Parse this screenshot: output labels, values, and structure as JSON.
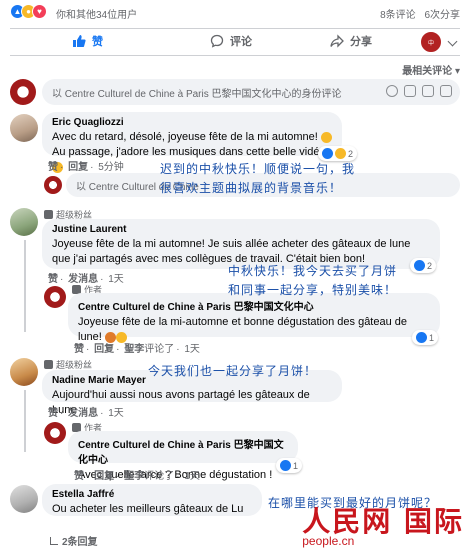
{
  "reactions_bar": {
    "summary": "你和其他34位用户",
    "comments": "8条评论",
    "shares": "6次分享"
  },
  "actions": {
    "like": "赞",
    "comment": "评论",
    "share": "分享"
  },
  "sort_label": "最相关评论",
  "comment_input": {
    "placeholder": "以 Centre Culturel de Chine à Paris 巴黎中国文化中心的身份评论"
  },
  "comments": [
    {
      "author": "Eric Quagliozzi",
      "text_line1": "Avec du retard, désolé, joyeuse fête de la mi automne!",
      "text_line2": "Au passage, j'adore les musiques dans cette belle vidéo",
      "like": "赞",
      "reply": "回复",
      "time": "5分钟",
      "reaction_count": "2"
    },
    {
      "badge": "超级粉丝",
      "author": "Justine Laurent",
      "text": "Joyeuse fête de la mi automne! Je suis allée acheter des gâteaux de lune que j'ai partagés avec mes collègues de travail. C'était bien bon!",
      "like": "赞",
      "reply": "发消息",
      "time": "1天",
      "reaction_count": "2",
      "reply_item": {
        "badge": "作者",
        "author": "Centre Culturel de Chine à Paris 巴黎中国文化中心",
        "text": "Joyeuse fête de la mi-automne et bonne dégustation des gâteau de lune!",
        "like": "赞",
        "reply": "回复",
        "by": "聖李",
        "by_suffix": "评论了",
        "time": "1天",
        "reaction_count": "1"
      }
    },
    {
      "badge": "超级粉丝",
      "author": "Nadine Marie Mayer",
      "text": "Aujourd'hui aussi nous avons partagé les gâteaux de Lune",
      "like": "赞",
      "reply": "发消息",
      "time": "1天",
      "reply_item": {
        "badge": "作者",
        "author": "Centre Culturel de Chine à Paris 巴黎中国文化中心",
        "text": "Avec quelle farce ? Bonne dégustation !",
        "like": "赞",
        "reply": "回复",
        "by": "聖李",
        "by_suffix": "评论了",
        "time": "1天",
        "reaction_count": "1"
      }
    },
    {
      "author": "Estella Jaffré",
      "text": "Ou acheter les meilleurs gâteaux de Lu",
      "more_replies": "2条回复"
    }
  ],
  "reply_input": {
    "placeholder": "以 Centre Culturel de Chine"
  },
  "translations": {
    "t1_line1": "迟到的中秋快乐！顺便说一句，我",
    "t1_line2": "很喜欢主题曲拟展的背景音乐！",
    "t2_line1": "中秋快乐！我今天去买了月饼",
    "t2_line2": "和同事一起分享，特别美味！",
    "t3": "今天我们也一起分享了月饼！",
    "t4": "在哪里能买到最好的月饼呢？"
  },
  "watermark": {
    "cn": "人民网 国际",
    "en": "people.cn"
  },
  "colors": {
    "accent": "#1877f2",
    "overlay_text": "#1a4fa8",
    "watermark": "#c8161d"
  }
}
